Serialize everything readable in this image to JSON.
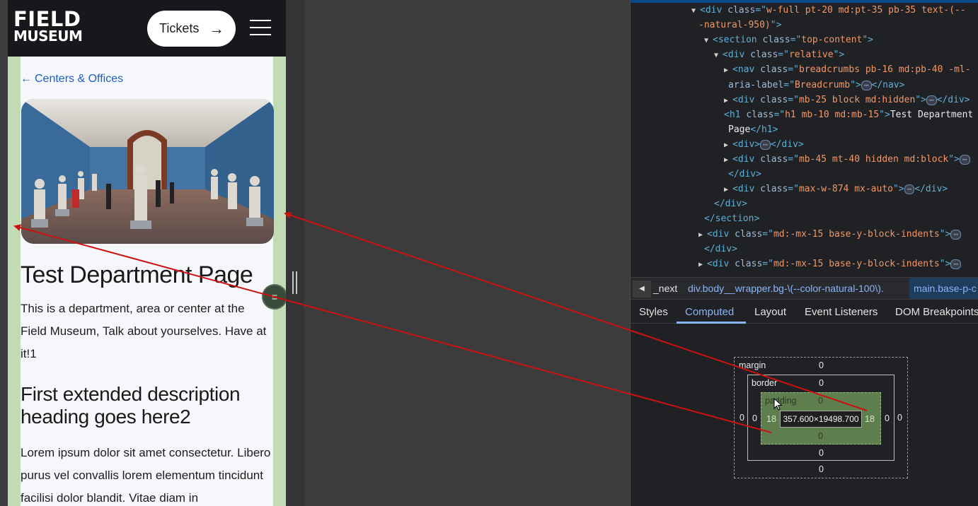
{
  "site": {
    "logo_line1": "FIELD",
    "logo_line2": "MUSEUM",
    "tickets_label": "Tickets",
    "tickets_arrow": "→",
    "breadcrumb_arrow": "←",
    "breadcrumb_label": "Centers & Offices",
    "page_title": "Test Department Page",
    "intro": "This is a department, area or center at the Field Museum, Talk about yourselves. Have at it!1",
    "section_heading": "First extended description heading goes here2",
    "body_text": "Lorem ipsum dolor sit amet consectetur. Libero purus vel convallis lorem elementum tincidunt facilisi dolor blandit. Vitae diam in",
    "fab_glyph": "≡"
  },
  "devtools": {
    "dom_lines": [
      {
        "indent": 0,
        "tri": "▼",
        "parts": [
          [
            "tag",
            "<div "
          ],
          [
            "attr",
            "class"
          ],
          [
            "tag",
            "=\""
          ],
          [
            "val",
            "w-full pt-20 md:pt-35 pb-35 text-(--"
          ]
        ]
      },
      {
        "indent": 1,
        "tri": "",
        "parts": [
          [
            "val",
            "-natural-950)"
          ],
          [
            "tag",
            "\">"
          ]
        ]
      },
      {
        "indent": 2,
        "tri": "▼",
        "parts": [
          [
            "tag",
            "<section "
          ],
          [
            "attr",
            "class"
          ],
          [
            "tag",
            "=\""
          ],
          [
            "val",
            "top-content"
          ],
          [
            "tag",
            "\">"
          ]
        ]
      },
      {
        "indent": 3,
        "tri": "▼",
        "parts": [
          [
            "tag",
            "<div "
          ],
          [
            "attr",
            "class"
          ],
          [
            "tag",
            "=\""
          ],
          [
            "val",
            "relative"
          ],
          [
            "tag",
            "\">"
          ]
        ]
      },
      {
        "indent": 4,
        "tri": "▶",
        "parts": [
          [
            "tag",
            "<nav "
          ],
          [
            "attr",
            "class"
          ],
          [
            "tag",
            "=\""
          ],
          [
            "val",
            "breadcrumbs pb-16 md:pb-40 -ml-"
          ]
        ]
      },
      {
        "indent": 5,
        "tri": "",
        "parts": [
          [
            "attr",
            "aria-label"
          ],
          [
            "tag",
            "=\""
          ],
          [
            "val",
            "Breadcrumb"
          ],
          [
            "tag",
            "\">"
          ],
          [
            "ell",
            "⋯"
          ],
          [
            "tag",
            "</nav>"
          ]
        ]
      },
      {
        "indent": 4,
        "tri": "▶",
        "parts": [
          [
            "tag",
            "<div "
          ],
          [
            "attr",
            "class"
          ],
          [
            "tag",
            "=\""
          ],
          [
            "val",
            "mb-25 block md:hidden"
          ],
          [
            "tag",
            "\">"
          ],
          [
            "ell",
            "⋯"
          ],
          [
            "tag",
            "</div>"
          ]
        ]
      },
      {
        "indent": 4,
        "tri": "",
        "parts": [
          [
            "tag",
            "<h1 "
          ],
          [
            "attr",
            "class"
          ],
          [
            "tag",
            "=\""
          ],
          [
            "val",
            "h1 mb-10 md:mb-15"
          ],
          [
            "tag",
            "\">"
          ],
          [
            "txt",
            "Test Department"
          ]
        ]
      },
      {
        "indent": 5,
        "tri": "",
        "parts": [
          [
            "txt",
            "Page"
          ],
          [
            "tag",
            "</h1>"
          ]
        ]
      },
      {
        "indent": 4,
        "tri": "▶",
        "parts": [
          [
            "tag",
            "<div>"
          ],
          [
            "ell",
            "⋯"
          ],
          [
            "tag",
            "</div>"
          ]
        ]
      },
      {
        "indent": 4,
        "tri": "▶",
        "parts": [
          [
            "tag",
            "<div "
          ],
          [
            "attr",
            "class"
          ],
          [
            "tag",
            "=\""
          ],
          [
            "val",
            "mb-45 mt-40 hidden md:block"
          ],
          [
            "tag",
            "\">"
          ],
          [
            "ell",
            "⋯"
          ]
        ]
      },
      {
        "indent": 5,
        "tri": "",
        "parts": [
          [
            "tag",
            "</div>"
          ]
        ]
      },
      {
        "indent": 4,
        "tri": "▶",
        "parts": [
          [
            "tag",
            "<div "
          ],
          [
            "attr",
            "class"
          ],
          [
            "tag",
            "=\""
          ],
          [
            "val",
            "max-w-874 mx-auto"
          ],
          [
            "tag",
            "\">"
          ],
          [
            "ell",
            "⋯"
          ],
          [
            "tag",
            "</div>"
          ]
        ]
      },
      {
        "indent": 3,
        "tri": "",
        "parts": [
          [
            "tag",
            "</div>"
          ]
        ]
      },
      {
        "indent": 2,
        "tri": "",
        "parts": [
          [
            "tag",
            "</section>"
          ]
        ]
      },
      {
        "indent": 1,
        "tri": "▶",
        "parts": [
          [
            "tag",
            "<div "
          ],
          [
            "attr",
            "class"
          ],
          [
            "tag",
            "=\""
          ],
          [
            "val",
            "md:-mx-15 base-y-block-indents"
          ],
          [
            "tag",
            "\">"
          ],
          [
            "ell",
            "⋯"
          ]
        ]
      },
      {
        "indent": 2,
        "tri": "",
        "parts": [
          [
            "tag",
            "</div>"
          ]
        ]
      },
      {
        "indent": 1,
        "tri": "▶",
        "parts": [
          [
            "tag",
            "<div "
          ],
          [
            "attr",
            "class"
          ],
          [
            "tag",
            "=\""
          ],
          [
            "val",
            "md:-mx-15 base-y-block-indents"
          ],
          [
            "tag",
            "\">"
          ],
          [
            "ell",
            "⋯"
          ]
        ]
      }
    ],
    "breadcrumbs": [
      "_next",
      "div.body__wrapper.bg-\\(--color-natural-100\\).",
      "main.base-p-c"
    ],
    "tabs": [
      "Styles",
      "Computed",
      "Layout",
      "Event Listeners",
      "DOM Breakpoints"
    ],
    "active_tab": "Computed",
    "box_model": {
      "margin_label": "margin",
      "border_label": "border",
      "padding_label": "padding",
      "margin": {
        "top": "0",
        "right": "0",
        "bottom": "0",
        "left": "0"
      },
      "border": {
        "top": "0",
        "right": "0",
        "bottom": "0",
        "left": "0"
      },
      "padding": {
        "top": "0",
        "right": "18",
        "bottom": "0",
        "left": "18"
      },
      "content": "357.600×19498.700"
    }
  },
  "colors": {
    "padding_highlight": "#c2dbb4",
    "accent_blue": "#8ab4f8",
    "annotation_arrow": "#cc1111"
  }
}
